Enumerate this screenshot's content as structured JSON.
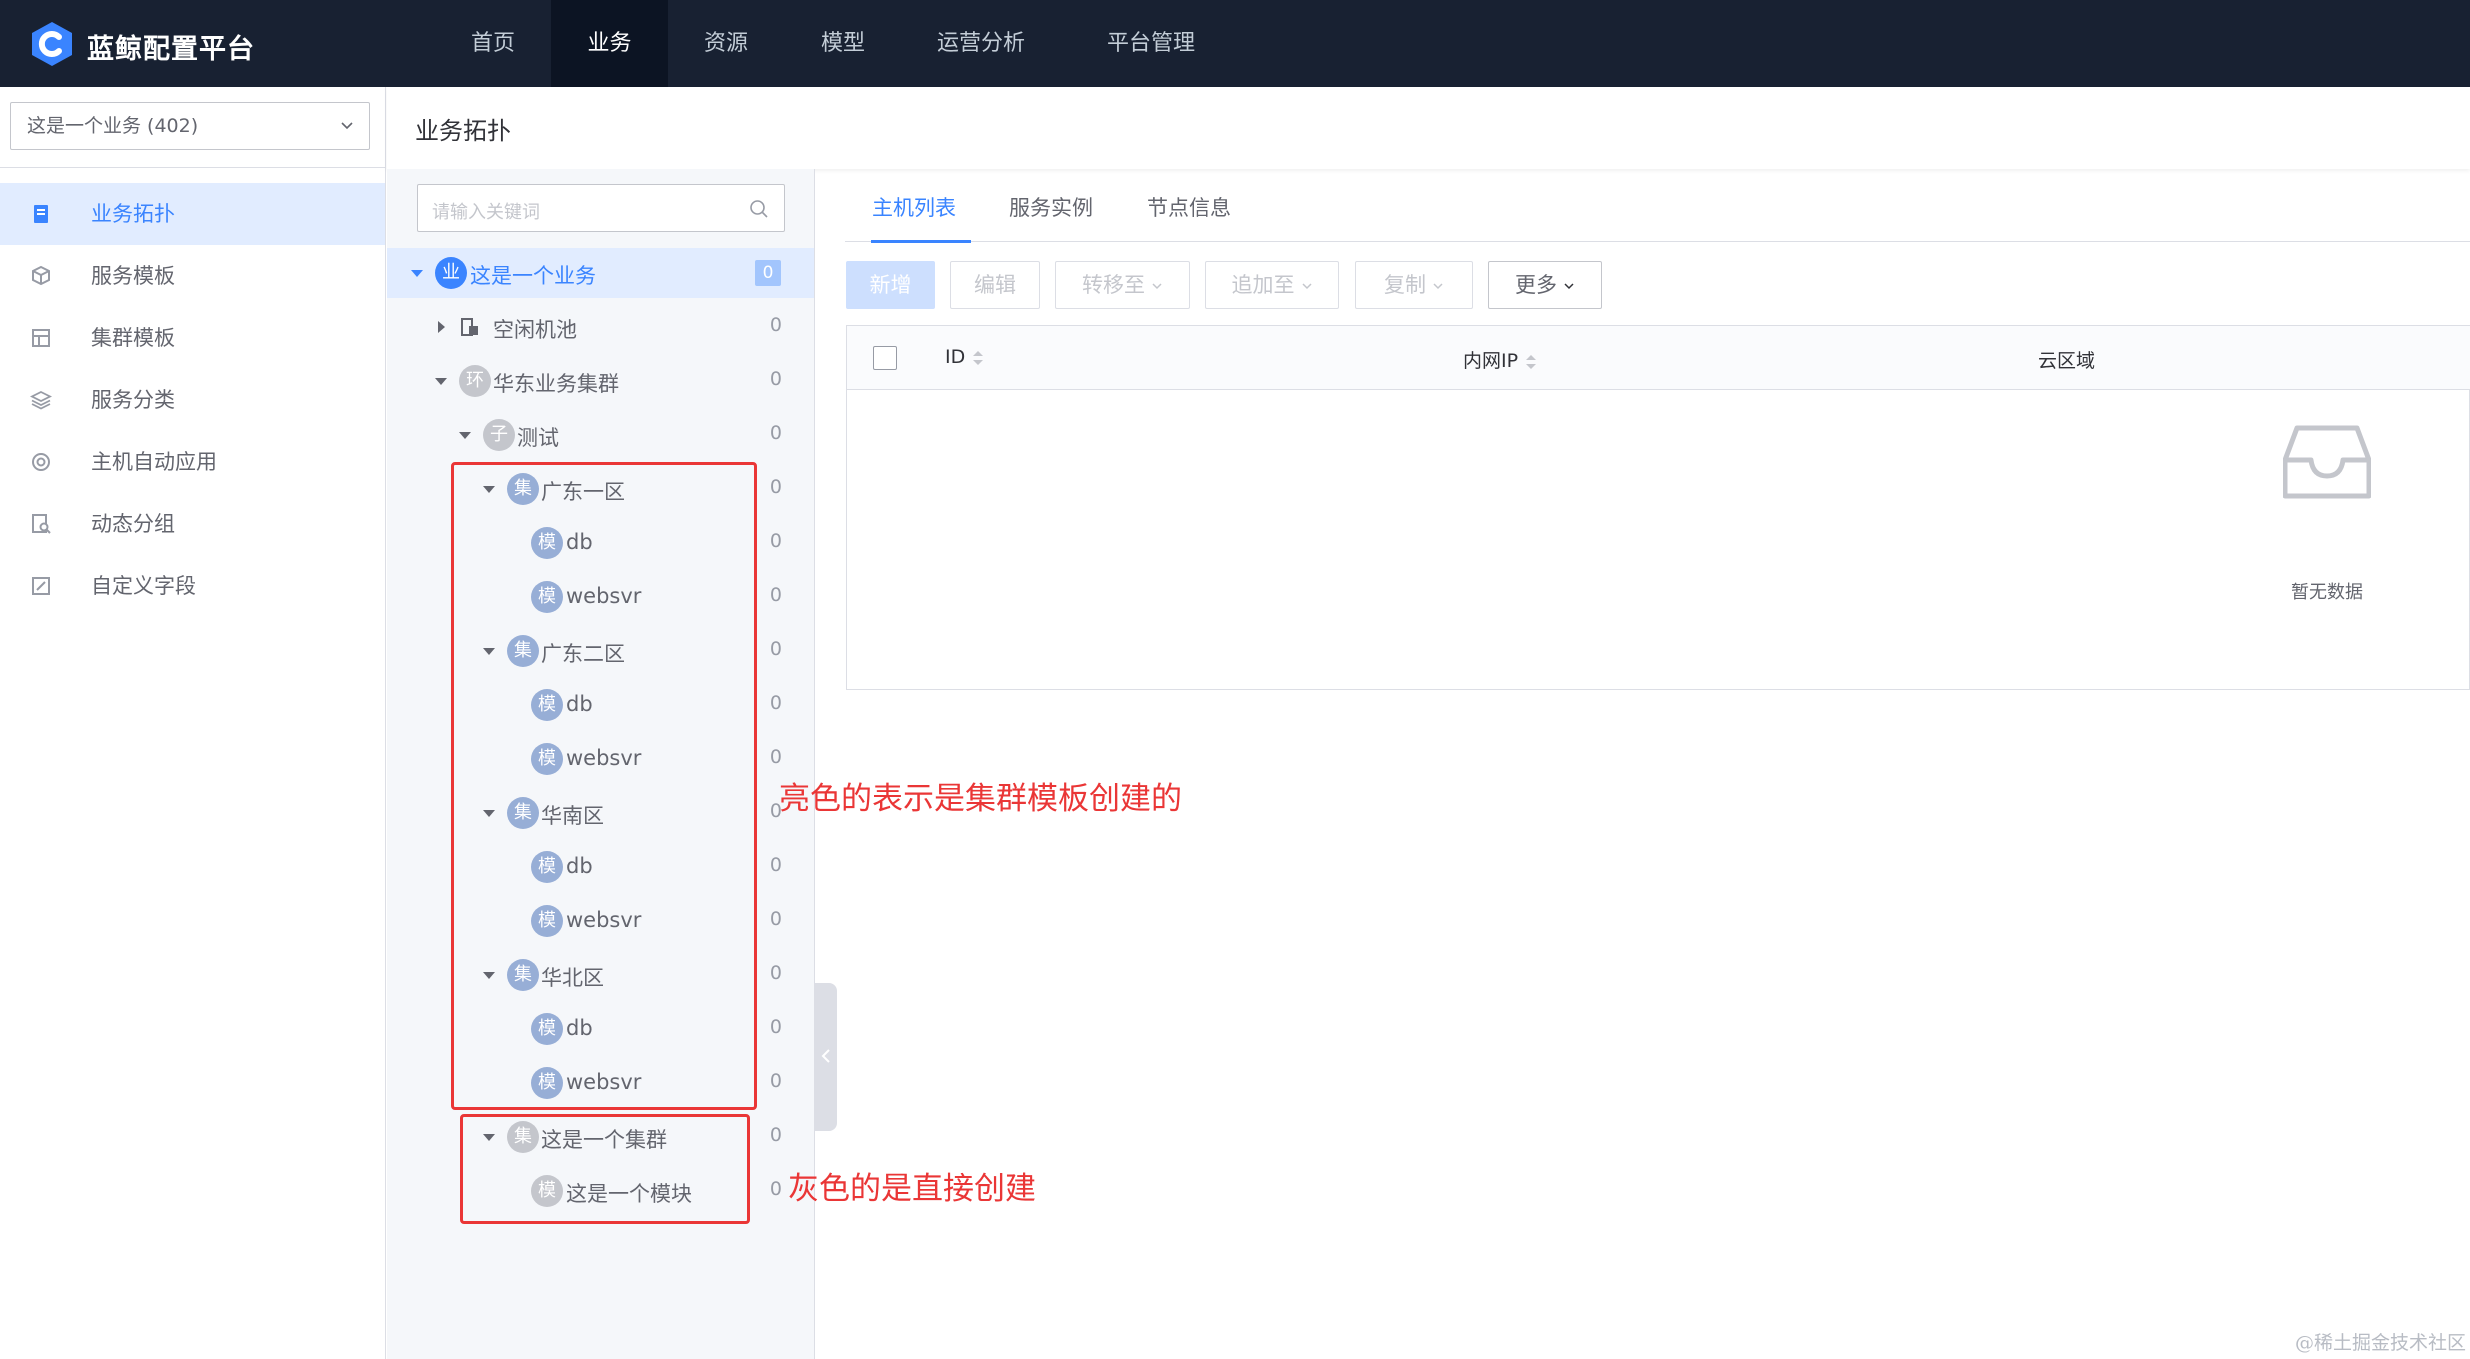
{
  "app": {
    "title": "蓝鲸配置平台"
  },
  "nav": {
    "items": [
      "首页",
      "业务",
      "资源",
      "模型",
      "运营分析",
      "平台管理"
    ],
    "active": "业务"
  },
  "sidebar": {
    "business_select": "这是一个业务 (402)",
    "items": [
      "业务拓扑",
      "服务模板",
      "集群模板",
      "服务分类",
      "主机自动应用",
      "动态分组",
      "自定义字段"
    ],
    "active": "业务拓扑"
  },
  "page": {
    "title": "业务拓扑"
  },
  "tree": {
    "search_placeholder": "请输入关键词",
    "badges": {
      "biz": "业",
      "idle": "",
      "env": "环",
      "sub": "子",
      "set": "集",
      "module": "模"
    },
    "nodes": {
      "biz": {
        "label": "这是一个业务",
        "count": "0"
      },
      "idle": {
        "label": "空闲机池",
        "count": "0"
      },
      "east": {
        "label": "华东业务集群",
        "count": "0"
      },
      "test": {
        "label": "测试",
        "count": "0"
      },
      "gd1": {
        "label": "广东一区",
        "count": "0"
      },
      "gd1_db": {
        "label": "db",
        "count": "0"
      },
      "gd1_web": {
        "label": "websvr",
        "count": "0"
      },
      "gd2": {
        "label": "广东二区",
        "count": "0"
      },
      "gd2_db": {
        "label": "db",
        "count": "0"
      },
      "gd2_web": {
        "label": "websvr",
        "count": "0"
      },
      "hn": {
        "label": "华南区",
        "count": "0"
      },
      "hn_db": {
        "label": "db",
        "count": "0"
      },
      "hn_web": {
        "label": "websvr",
        "count": "0"
      },
      "hb": {
        "label": "华北区",
        "count": "0"
      },
      "hb_db": {
        "label": "db",
        "count": "0"
      },
      "hb_web": {
        "label": "websvr",
        "count": "0"
      },
      "cluster": {
        "label": "这是一个集群",
        "count": "0"
      },
      "module": {
        "label": "这是一个模块",
        "count": "0"
      }
    }
  },
  "annotations": {
    "bright": "亮色的表示是集群模板创建的",
    "gray": "灰色的是直接创建"
  },
  "tabs": {
    "items": [
      "主机列表",
      "服务实例",
      "节点信息"
    ],
    "active": "主机列表"
  },
  "toolbar": {
    "add": "新增",
    "edit": "编辑",
    "transfer": "转移至",
    "append": "追加至",
    "copy": "复制",
    "more": "更多"
  },
  "table": {
    "columns": [
      "ID",
      "内网IP",
      "云区域"
    ],
    "empty_text": "暂无数据"
  },
  "watermark": "@稀土掘金技术社区",
  "colors": {
    "topbar": "#182132",
    "accent": "#3a84ff",
    "annotation": "#ea3636",
    "bright_badge": "#97aed6",
    "gray_badge": "#c4c6cc"
  }
}
